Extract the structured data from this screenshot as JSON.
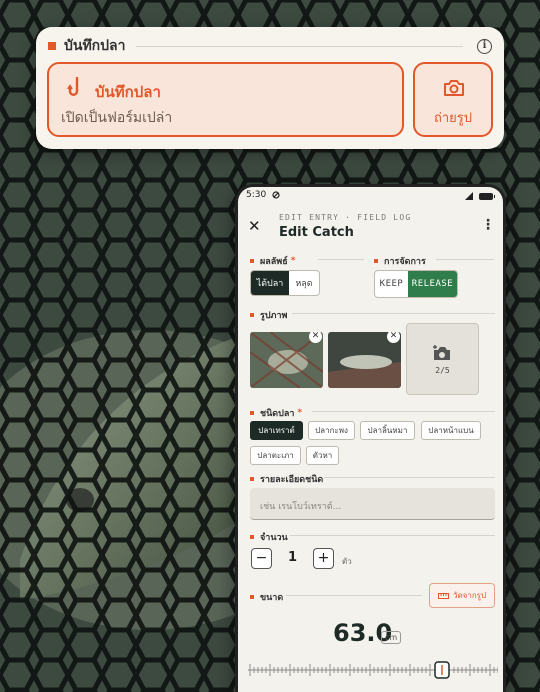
{
  "widget": {
    "title": "บันทึกปลา",
    "new_entry": {
      "label": "บันทึกปลา",
      "sub": "เปิดเป็นฟอร์มเปล่า"
    },
    "photo_button": {
      "label": "ถ่ายรูป"
    },
    "accent": "#e2582a"
  },
  "phone": {
    "status": {
      "time": "5:30"
    },
    "appbar": {
      "eyebrow": "EDIT ENTRY · FIELD LOG",
      "title": "Edit Catch",
      "close": "✕",
      "more": "⋮"
    },
    "result": {
      "label": "ผลลัพธ์",
      "required": "*",
      "options": [
        "ได้ปลา",
        "หลุด"
      ],
      "selected": "ได้ปลา"
    },
    "action": {
      "label": "การจัดการ",
      "options": [
        "KEEP",
        "RELEASE"
      ],
      "selected": "RELEASE"
    },
    "photos": {
      "label": "รูปภาพ",
      "count": "2/5"
    },
    "species": {
      "label": "ชนิดปลา",
      "required": "*",
      "options": [
        "ปลาเทราต์",
        "ปลากะพง",
        "ปลาลิ้นหมา",
        "ปลาหน้าแบน",
        "ปลาตะเภา",
        "ตัวหา"
      ],
      "selected": "ปลาเทราต์"
    },
    "details": {
      "label": "รายละเอียดชนิด",
      "placeholder": "เช่น เรนโบว์เทราต์..."
    },
    "quantity": {
      "label": "จำนวน",
      "value": "1",
      "unit": "ตัว",
      "minus": "−",
      "plus": "+"
    },
    "size": {
      "label": "ขนาด",
      "value": "63.0",
      "unit": "cm",
      "from_photo": "วัดจากรูป"
    },
    "colors": {
      "dark": "#1d2a26",
      "green": "#2e7d4a",
      "accent": "#e2582a"
    }
  }
}
